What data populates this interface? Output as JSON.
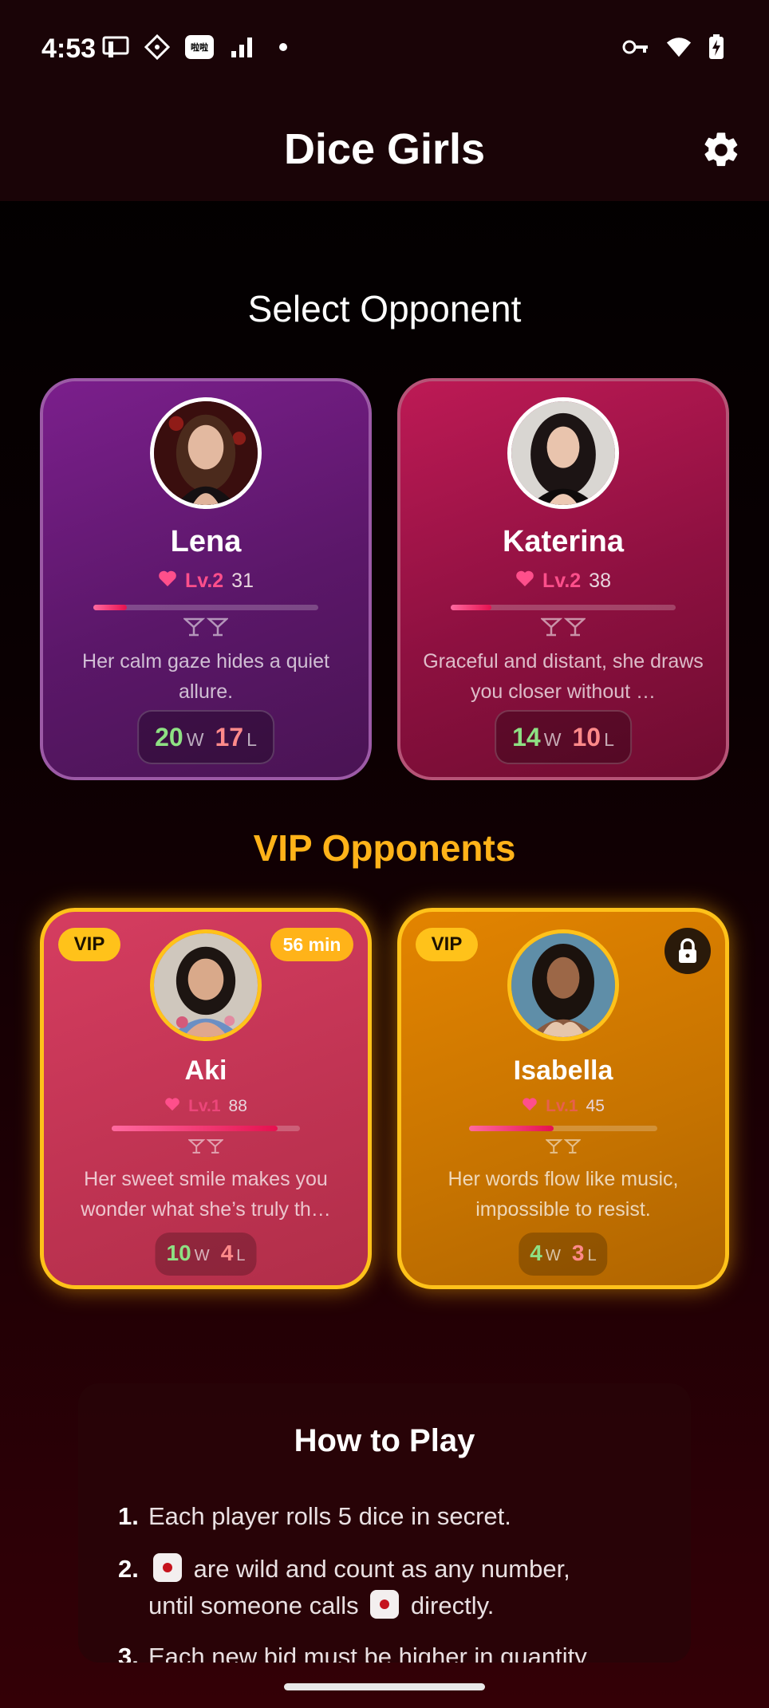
{
  "status": {
    "time": "4:53",
    "left_icons": [
      "cast-icon",
      "diamond-icon",
      "app-badge-icon",
      "signal-icon",
      "dot-icon"
    ],
    "right_icons": [
      "vpn-key-icon",
      "wifi-icon",
      "battery-charging-icon"
    ],
    "app_badge_text": "啦啦"
  },
  "appbar": {
    "title": "Dice Girls",
    "settings_icon": "gear-icon"
  },
  "select_title": "Select Opponent",
  "opponents": [
    {
      "name": "Lena",
      "level": "Lv.2",
      "points": "31",
      "progress": 0.15,
      "description": "Her calm gaze hides a quiet allure.",
      "wins": "20",
      "w_label": "W",
      "losses": "17",
      "l_label": "L"
    },
    {
      "name": "Katerina",
      "level": "Lv.2",
      "points": "38",
      "progress": 0.18,
      "description": "Graceful and distant, she draws you closer without …",
      "wins": "14",
      "w_label": "W",
      "losses": "10",
      "l_label": "L"
    }
  ],
  "vip_title": "VIP Opponents",
  "vip_opponents": [
    {
      "badge": "VIP",
      "timer": "56 min",
      "name": "Aki",
      "level": "Lv.1",
      "points": "88",
      "progress": 0.88,
      "description": "Her sweet smile makes you wonder what she’s truly th…",
      "wins": "10",
      "w_label": "W",
      "losses": "4",
      "l_label": "L"
    },
    {
      "badge": "VIP",
      "locked": true,
      "name": "Isabella",
      "level": "Lv.1",
      "points": "45",
      "progress": 0.45,
      "description": "Her words flow like music, impossible to resist.",
      "wins": "4",
      "w_label": "W",
      "losses": "3",
      "l_label": "L"
    }
  ],
  "howto": {
    "title": "How to Play",
    "steps": [
      {
        "num": "1.",
        "text": "Each player rolls 5 dice in secret."
      },
      {
        "num": "2.",
        "text_a": "are wild and count as any number,",
        "text_b": "until someone calls",
        "text_c": "directly."
      },
      {
        "num": "3.",
        "text": "Each new bid must be higher in quantity"
      }
    ]
  },
  "colors": {
    "accent_gold": "#ffb319",
    "level_pink": "#ff4f8b",
    "win_green": "#8ee083",
    "loss_red": "#ff8a8a"
  }
}
